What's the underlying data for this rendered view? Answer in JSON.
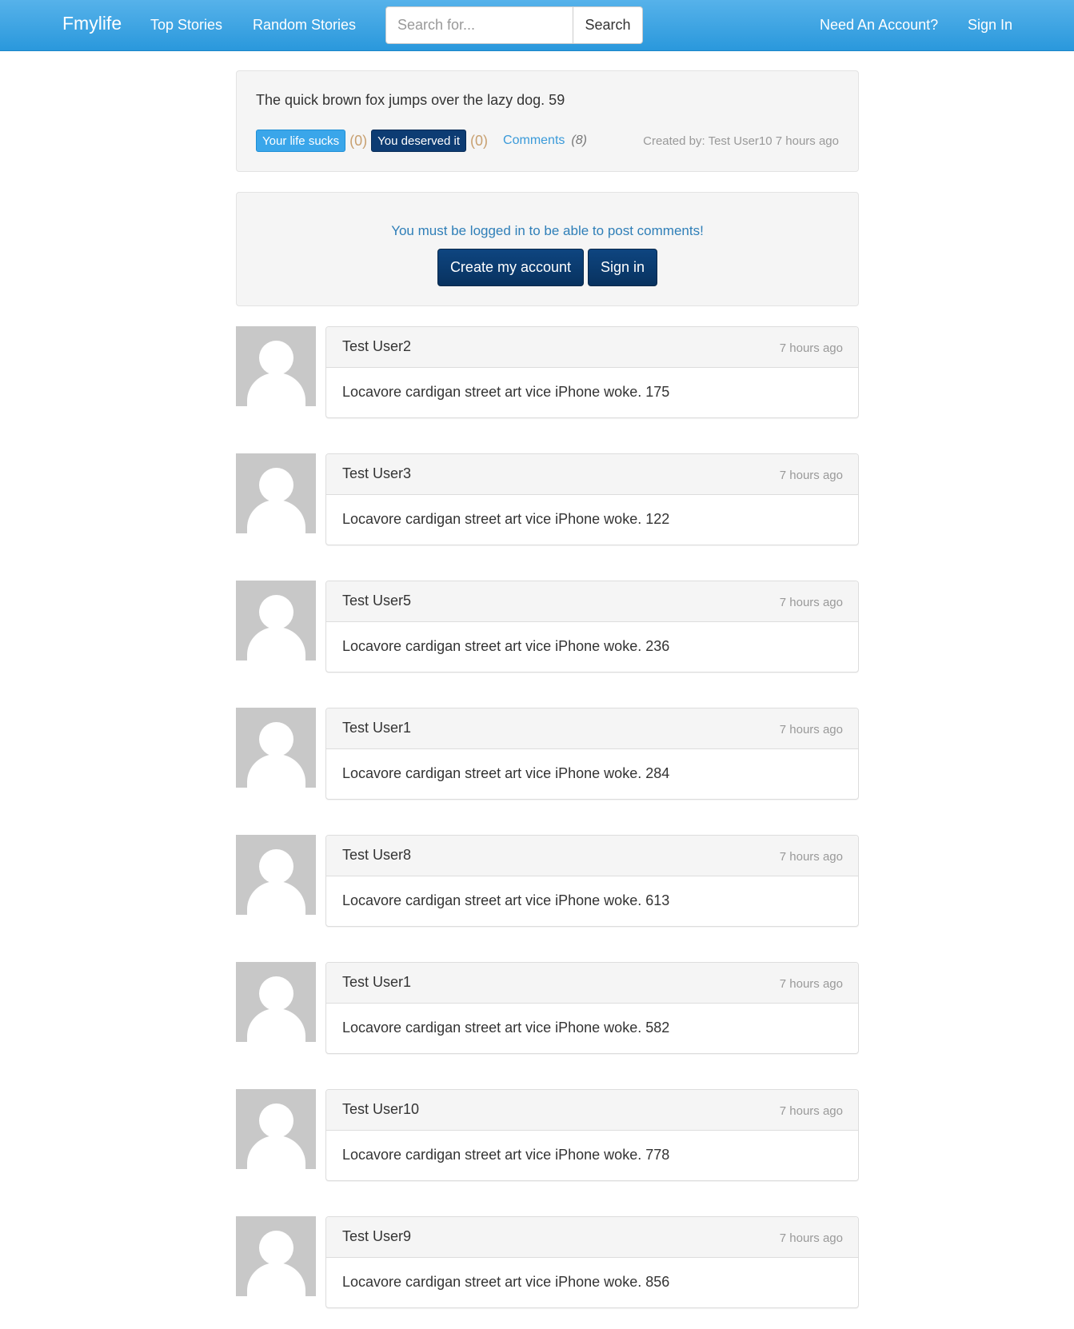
{
  "navbar": {
    "brand": "Fmylife",
    "top_stories": "Top Stories",
    "random_stories": "Random Stories",
    "search_placeholder": "Search for...",
    "search_button": "Search",
    "need_account": "Need An Account?",
    "sign_in": "Sign In"
  },
  "story": {
    "text": "The quick brown fox jumps over the lazy dog. 59",
    "sucks_label": "Your life sucks",
    "sucks_count": "(0)",
    "deserved_label": "You deserved it",
    "deserved_count": "(0)",
    "comments_label": "Comments",
    "comments_count": "(8)",
    "created_by": "Created by: Test User10 7 hours ago"
  },
  "login_prompt": {
    "message": "You must be logged in to be able to post comments!",
    "create_account": "Create my account",
    "sign_in": "Sign in"
  },
  "comments": [
    {
      "user": "Test User2",
      "time": "7 hours ago",
      "text": "Locavore cardigan street art vice iPhone woke. 175"
    },
    {
      "user": "Test User3",
      "time": "7 hours ago",
      "text": "Locavore cardigan street art vice iPhone woke. 122"
    },
    {
      "user": "Test User5",
      "time": "7 hours ago",
      "text": "Locavore cardigan street art vice iPhone woke. 236"
    },
    {
      "user": "Test User1",
      "time": "7 hours ago",
      "text": "Locavore cardigan street art vice iPhone woke. 284"
    },
    {
      "user": "Test User8",
      "time": "7 hours ago",
      "text": "Locavore cardigan street art vice iPhone woke. 613"
    },
    {
      "user": "Test User1",
      "time": "7 hours ago",
      "text": "Locavore cardigan street art vice iPhone woke. 582"
    },
    {
      "user": "Test User10",
      "time": "7 hours ago",
      "text": "Locavore cardigan street art vice iPhone woke. 778"
    },
    {
      "user": "Test User9",
      "time": "7 hours ago",
      "text": "Locavore cardigan street art vice iPhone woke. 856"
    }
  ]
}
